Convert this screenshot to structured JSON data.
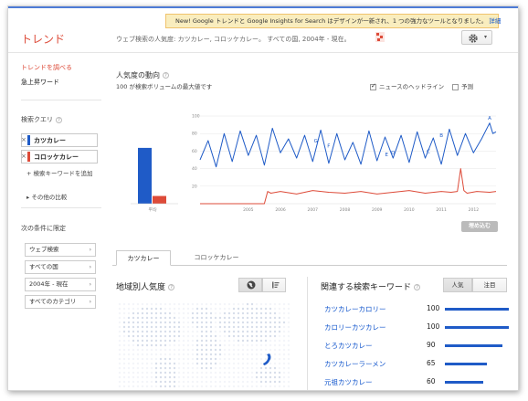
{
  "notice": {
    "text": "New! Google トレンドと Google Insights for Search はデザインが一新され、1 つの強力なツールとなりました。",
    "link": "詳細"
  },
  "header": {
    "logo": "トレンド",
    "query_description": "ウェブ検索の人気度: カツカレー, コロッケカレー。 すべての国, 2004年 - 現在。"
  },
  "sidebar": {
    "nav": [
      "トレンドを調べる",
      "急上昇ワード"
    ],
    "query_label": "検索クエリ",
    "terms": [
      {
        "label": "カツカレー",
        "color": "#1f5bc7"
      },
      {
        "label": "コロッケカレー",
        "color": "#dd4b39"
      }
    ],
    "add_term": "+ 検索キーワードを追加",
    "compare_more": "その他の比較",
    "limit_label": "次の条件に限定",
    "filters": [
      "ウェブ検索",
      "すべての国",
      "2004年 - 現在",
      "すべてのカテゴリ"
    ]
  },
  "interest": {
    "title": "人気度の動向",
    "subtitle": "100 が検索ボリュームの最大値です",
    "news_headlines": "ニュースのヘッドライン",
    "forecast": "予測",
    "average_label": "平均",
    "embed_button": "埋め込む"
  },
  "chart_data": {
    "type": "line",
    "title": "人気度の動向",
    "x_ticks": [
      "2005",
      "2006",
      "2007",
      "2008",
      "2009",
      "2010",
      "2011",
      "2012"
    ],
    "y_ticks": [
      "100",
      "80",
      "60",
      "40",
      "20"
    ],
    "ylim": [
      0,
      100
    ],
    "xlim": [
      2004.0,
      2013.2
    ],
    "news_markers": [
      "G",
      "F",
      "E",
      "D",
      "C",
      "B",
      "A"
    ],
    "averages": [
      {
        "name": "カツカレー",
        "value": 65,
        "color": "#1f5bc7"
      },
      {
        "name": "コロッケカレー",
        "value": 9,
        "color": "#dd4b39"
      }
    ],
    "series": [
      {
        "name": "カツカレー",
        "color": "#1f5bc7",
        "x": [
          2004.0,
          2004.25,
          2004.5,
          2004.75,
          2005.0,
          2005.25,
          2005.5,
          2005.75,
          2006.0,
          2006.25,
          2006.5,
          2006.75,
          2007.0,
          2007.25,
          2007.5,
          2007.75,
          2008.0,
          2008.25,
          2008.5,
          2008.75,
          2009.0,
          2009.25,
          2009.5,
          2009.75,
          2010.0,
          2010.25,
          2010.5,
          2010.75,
          2011.0,
          2011.25,
          2011.5,
          2011.75,
          2012.0,
          2012.25,
          2012.5,
          2012.75,
          2013.0,
          2013.1,
          2013.2
        ],
        "values": [
          50,
          72,
          42,
          80,
          48,
          83,
          55,
          78,
          44,
          86,
          58,
          74,
          52,
          78,
          48,
          84,
          46,
          80,
          50,
          70,
          45,
          83,
          49,
          76,
          52,
          78,
          47,
          82,
          52,
          75,
          45,
          85,
          55,
          80,
          58,
          74,
          92,
          80,
          82
        ]
      },
      {
        "name": "コロッケカレー",
        "color": "#dd4b39",
        "x": [
          2004.0,
          2005.0,
          2006.0,
          2006.1,
          2006.2,
          2006.5,
          2007.0,
          2007.5,
          2008.0,
          2008.5,
          2009.0,
          2009.5,
          2010.0,
          2010.5,
          2011.0,
          2011.5,
          2011.8,
          2012.0,
          2012.1,
          2012.2,
          2012.3,
          2012.6,
          2013.0,
          2013.2
        ],
        "values": [
          0,
          0,
          0,
          14,
          12,
          14,
          11,
          15,
          13,
          12,
          14,
          11,
          13,
          15,
          12,
          14,
          13,
          14,
          40,
          15,
          12,
          14,
          13,
          14
        ]
      }
    ]
  },
  "tabs": [
    "カツカレー",
    "コロッケカレー"
  ],
  "regional": {
    "title": "地域別人気度"
  },
  "related": {
    "title": "関連する検索キーワード",
    "tab_popular": "人気",
    "tab_rising": "注目",
    "items": [
      {
        "keyword": "カツカレーカロリー",
        "value": 100
      },
      {
        "keyword": "カロリーカツカレー",
        "value": 100
      },
      {
        "keyword": "とろカツカレー",
        "value": 90
      },
      {
        "keyword": "カツカレーラーメン",
        "value": 65
      },
      {
        "keyword": "元祖カツカレー",
        "value": 60
      }
    ]
  }
}
